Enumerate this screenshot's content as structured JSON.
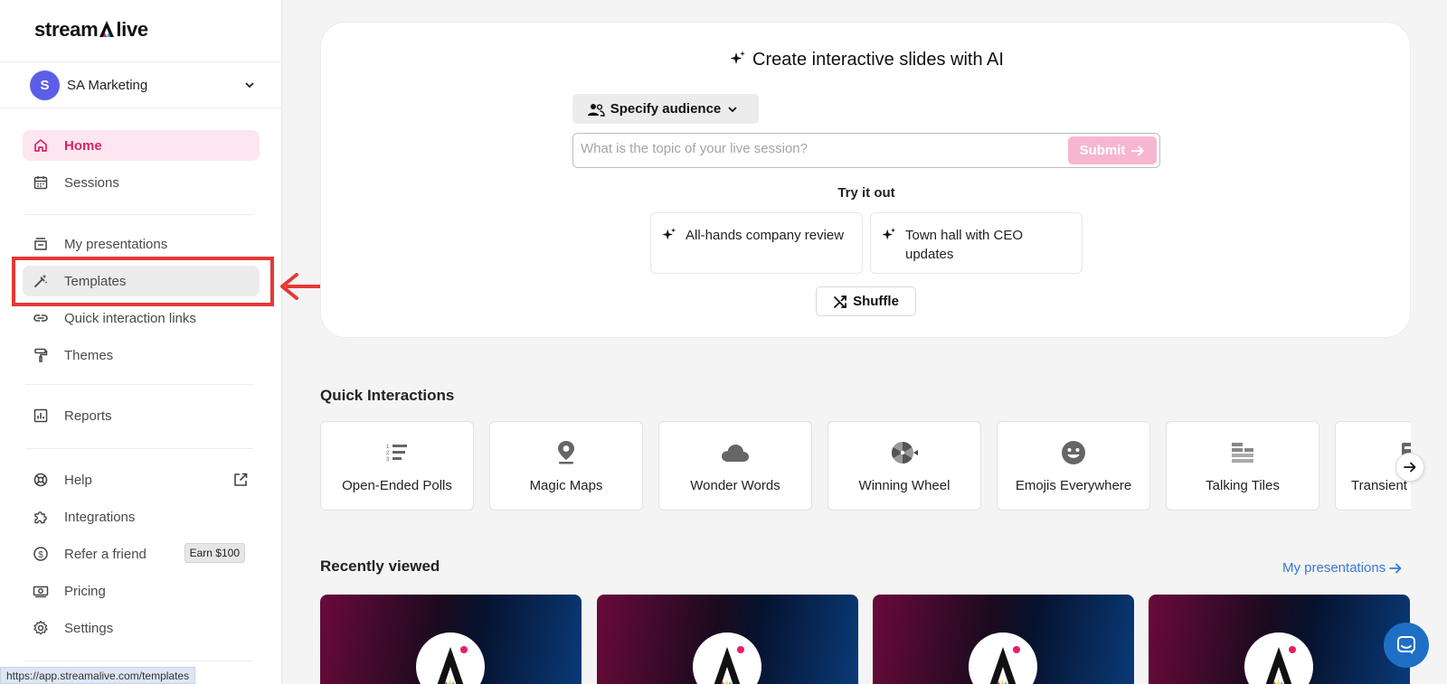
{
  "app": {
    "logo_text_left": "stream",
    "logo_text_right": "live"
  },
  "org": {
    "avatar_letter": "S",
    "name": "SA Marketing"
  },
  "sidebar": {
    "items": [
      {
        "label": "Home",
        "icon": "home-icon"
      },
      {
        "label": "Sessions",
        "icon": "calendar-icon"
      },
      {
        "label": "My presentations",
        "icon": "presentation-icon"
      },
      {
        "label": "Templates",
        "icon": "magic-wand-icon"
      },
      {
        "label": "Quick interaction links",
        "icon": "link-icon"
      },
      {
        "label": "Themes",
        "icon": "paint-roller-icon"
      },
      {
        "label": "Reports",
        "icon": "chart-icon"
      },
      {
        "label": "Help",
        "icon": "lifebuoy-icon"
      },
      {
        "label": "Integrations",
        "icon": "puzzle-icon"
      },
      {
        "label": "Refer a friend",
        "icon": "dollar-icon",
        "badge": "Earn $100"
      },
      {
        "label": "Pricing",
        "icon": "money-icon"
      },
      {
        "label": "Settings",
        "icon": "gear-icon"
      }
    ]
  },
  "status_bar": {
    "url": "https://app.streamalive.com/templates"
  },
  "ai": {
    "title": "Create interactive slides with AI",
    "audience_label": "Specify audience",
    "topic_placeholder": "What is the topic of your live session?",
    "submit_label": "Submit",
    "try_label": "Try it out",
    "suggestions": [
      "All-hands company review",
      "Town hall with CEO updates"
    ],
    "shuffle_label": "Shuffle"
  },
  "quick_interactions": {
    "title": "Quick Interactions",
    "items": [
      {
        "label": "Open-Ended Polls",
        "icon": "list-icon"
      },
      {
        "label": "Magic Maps",
        "icon": "map-pin-icon"
      },
      {
        "label": "Wonder Words",
        "icon": "cloud-icon"
      },
      {
        "label": "Winning Wheel",
        "icon": "wheel-icon"
      },
      {
        "label": "Emojis Everywhere",
        "icon": "smiley-icon"
      },
      {
        "label": "Talking Tiles",
        "icon": "tiles-icon"
      },
      {
        "label": "Transient",
        "icon": "transient-icon"
      }
    ]
  },
  "recently_viewed": {
    "title": "Recently viewed",
    "link_label": "My presentations"
  },
  "colors": {
    "accent_pink": "#d6246b",
    "link_blue": "#3a78d8",
    "highlight_red": "#e53935"
  }
}
